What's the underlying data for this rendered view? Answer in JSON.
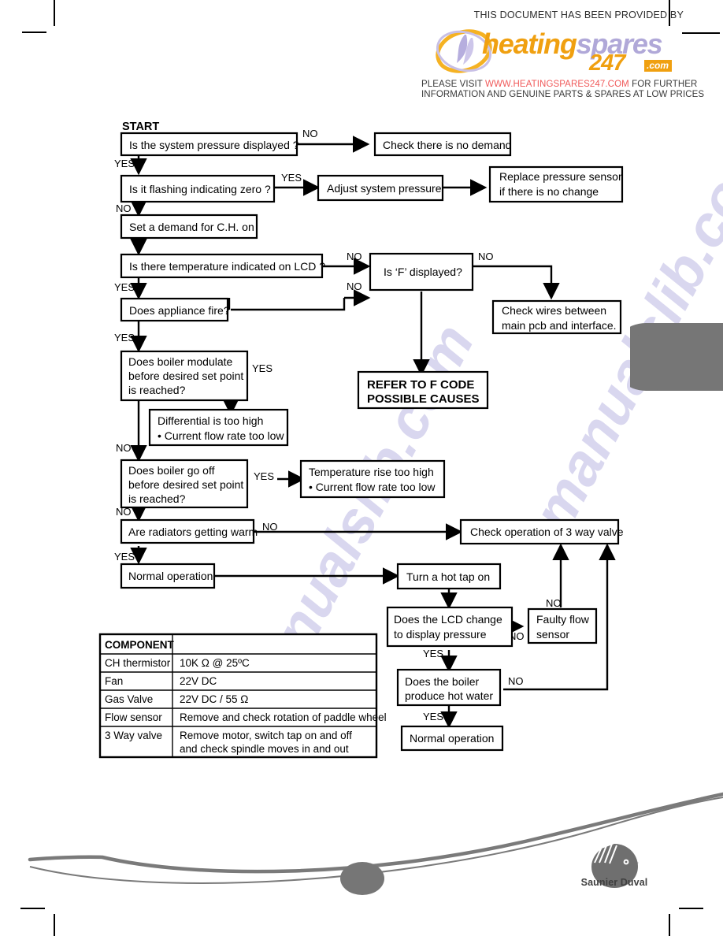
{
  "promo": {
    "top_line": "THIS DOCUMENT HAS BEEN PROVIDED BY",
    "logo_heating": "heating",
    "logo_spares": "spares",
    "logo_247": "247",
    "logo_com": ".com",
    "line1_a": "PLEASE VISIT ",
    "line1_url": "WWW.HEATINGSPARES247.COM",
    "line1_b": " FOR FURTHER",
    "line2": "INFORMATION AND GENUINE PARTS & SPARES AT LOW PRICES",
    "colors": {
      "orange": "#f0a010",
      "purple": "#b0a8d8",
      "red": "#f05a5a"
    }
  },
  "watermark": {
    "text1": "manualslib.com",
    "text2": "manualslib.com"
  },
  "flow": {
    "start_label": "START",
    "nodes": {
      "n1": "Is the system pressure displayed ?",
      "n2": "Check there is no demand",
      "n3": "Is it flashing indicating zero ?",
      "n4": "Adjust system pressure",
      "n5a": "Replace pressure sensor",
      "n5b": "if there is no change",
      "n6": "Set a demand for C.H. on",
      "n7": "Is there temperature indicated on LCD ?",
      "n8": "Is ‘F’ displayed?",
      "n9a": "Check wires between",
      "n9b": "main pcb and interface.",
      "n10": "Does appliance fire?",
      "n11a": "REFER TO F CODE",
      "n11b": "POSSIBLE CAUSES",
      "n12a": "Does boiler modulate",
      "n12b": "before desired set point",
      "n12c": "is reached?",
      "n13a": "Differential is too high",
      "n13b": "• Current flow rate too low",
      "n14a": "Does boiler go off",
      "n14b": "before desired set point",
      "n14c": "is reached?",
      "n15a": "Temperature rise too high",
      "n15b": "• Current flow rate too low",
      "n16": "Are radiators getting warm",
      "n17": "Normal operation",
      "n18": "Check operation of 3 way valve",
      "n19": "Turn a hot tap on",
      "n20a": "Does the LCD change",
      "n20b": "to display pressure",
      "n21a": "Faulty flow",
      "n21b": "sensor",
      "n22a": "Does the boiler",
      "n22b": "produce hot water",
      "n23": "Normal operation"
    },
    "edge_labels": {
      "e1": "NO",
      "e2": "YES",
      "e3": "YES",
      "e4": "NO",
      "e5": "NO",
      "e6": "NO",
      "e7": "NO",
      "e8": "YES",
      "e9": "YES",
      "e10": "NO",
      "e11": "YES",
      "e12": "NO",
      "e13": "NO",
      "e14": "YES",
      "e15": "NO",
      "e16": "NO",
      "e17": "YES",
      "e18": "NO",
      "e19": "YES"
    }
  },
  "table": {
    "header": "COMPONENT",
    "rows": [
      {
        "name": "CH thermistor",
        "value": "10K Ω  @ 25ºC"
      },
      {
        "name": "Fan",
        "value": "22V DC"
      },
      {
        "name": "Gas Valve",
        "value": "22V DC / 55 Ω"
      },
      {
        "name": "Flow sensor",
        "value": "Remove and check rotation of paddle wheel"
      },
      {
        "name": "3 Way valve",
        "value": "Remove motor, switch tap on and off",
        "value2": "and check spindle moves in and out"
      }
    ]
  },
  "footer": {
    "brand": "Saunier Duval"
  }
}
